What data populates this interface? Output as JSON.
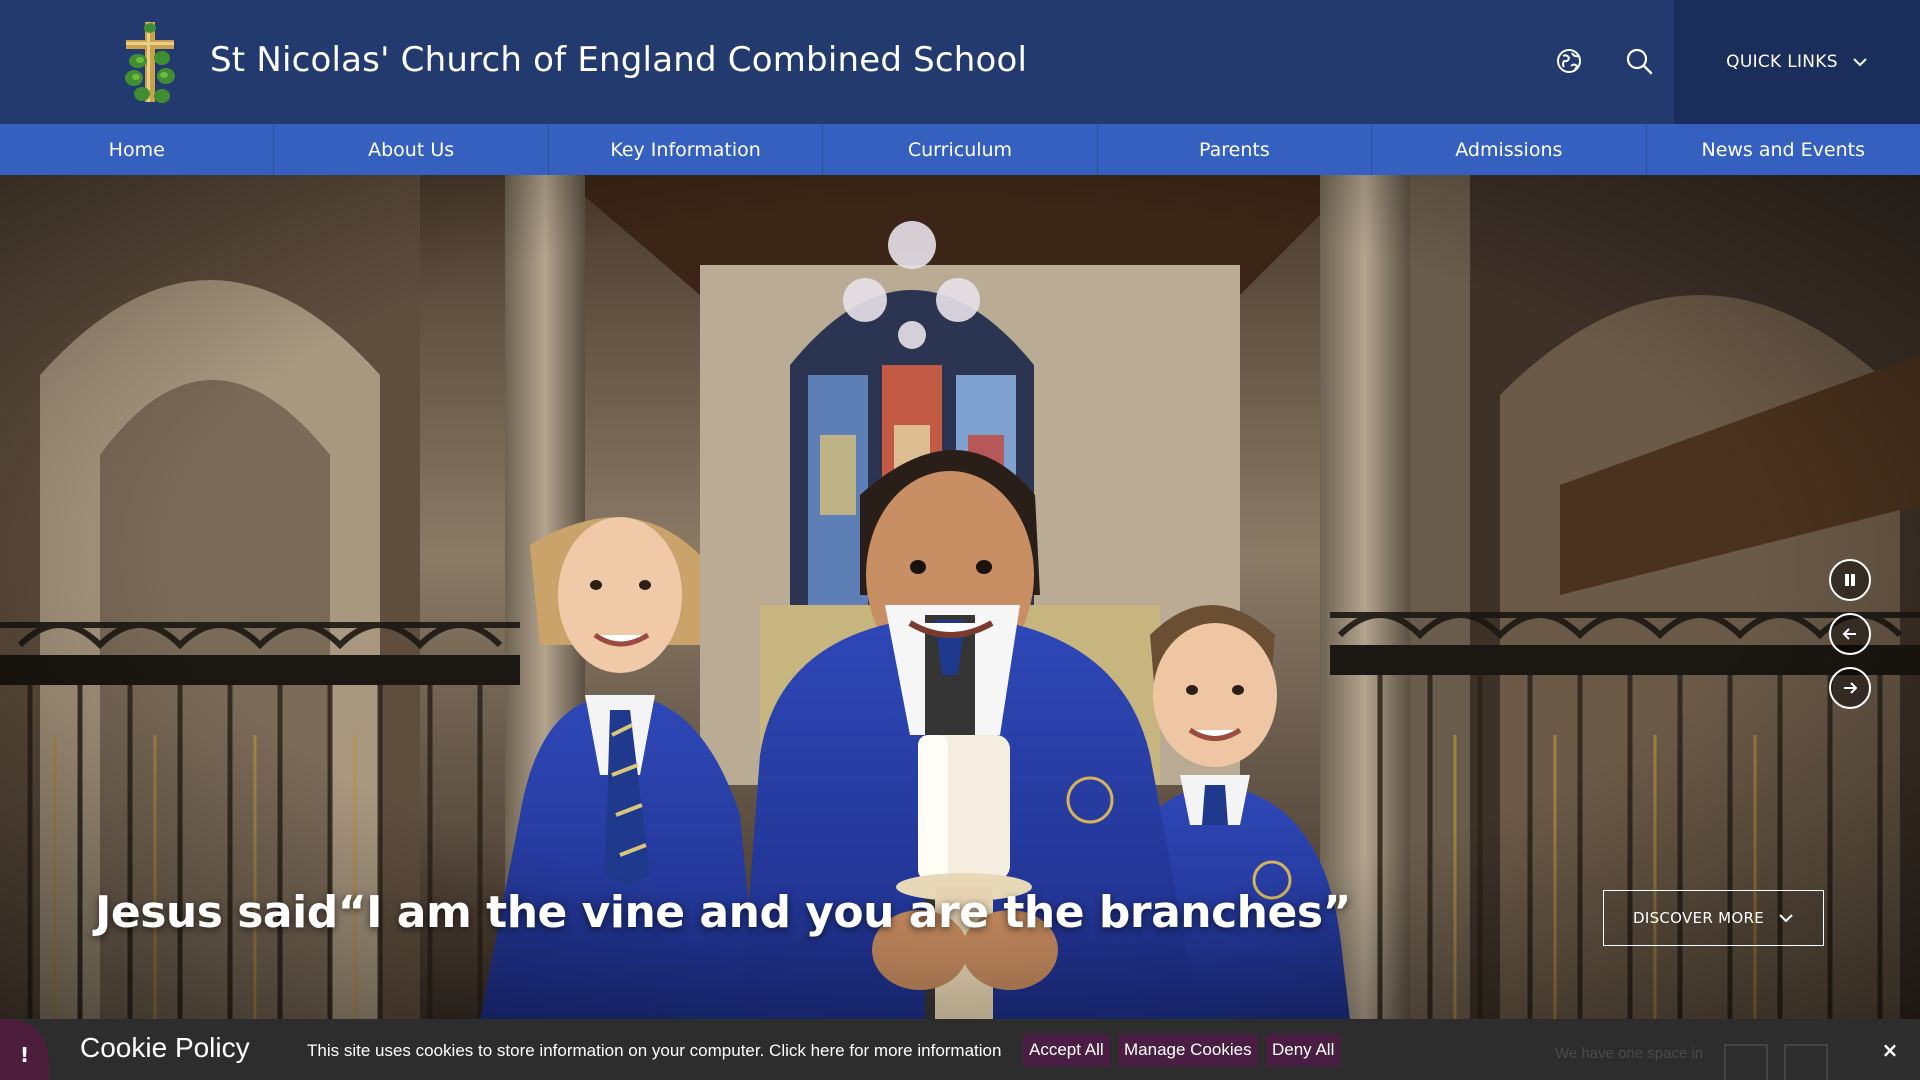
{
  "header": {
    "school_name": "St Nicolas' Church of England Combined School",
    "quick_links_label": "QUICK LINKS",
    "icons": [
      "translate-globe-icon",
      "search-icon",
      "chevron-down-icon"
    ],
    "colors": {
      "header_bg": "#233a6e",
      "quick_links_bg": "#1b2d5b",
      "nav_bg": "#3560bf"
    }
  },
  "nav": {
    "items": [
      {
        "label": "Home"
      },
      {
        "label": "About Us"
      },
      {
        "label": "Key Information"
      },
      {
        "label": "Curriculum"
      },
      {
        "label": "Parents"
      },
      {
        "label": "Admissions"
      },
      {
        "label": "News and Events"
      }
    ]
  },
  "hero": {
    "caption": "Jesus said“I am the vine and you are the branches”",
    "discover_label": "DISCOVER MORE",
    "controls": [
      "pause-icon",
      "arrow-left-icon",
      "arrow-right-icon"
    ]
  },
  "cookie": {
    "alert_symbol": "!",
    "title": "Cookie Policy",
    "text": "This site uses cookies to store information on your computer. Click here for more information",
    "accept_label": "Accept All",
    "manage_label": "Manage Cookies",
    "deny_label": "Deny All",
    "close_symbol": "×",
    "colors": {
      "bar_bg": "#2d2d2d",
      "button_bg": "#4a1e42"
    }
  },
  "behind_bar": {
    "text": "We have one space in"
  }
}
